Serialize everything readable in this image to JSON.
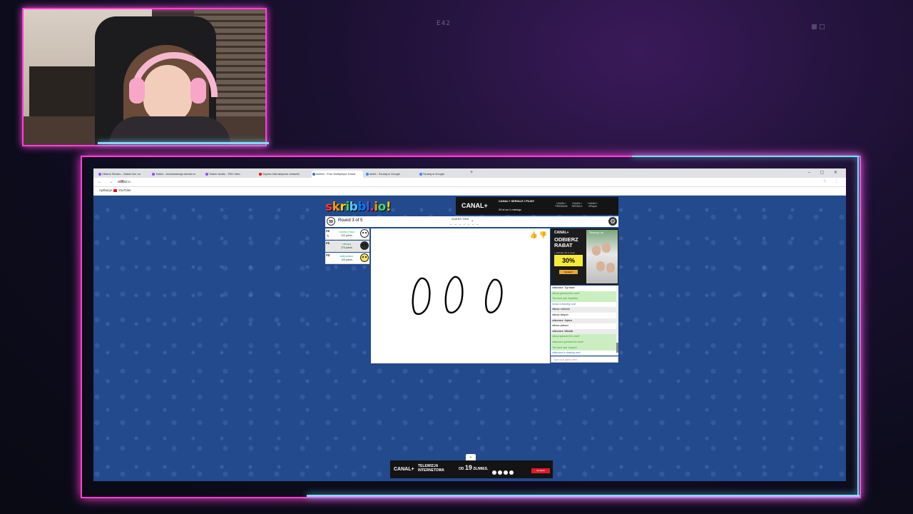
{
  "stream": {
    "label": "E42"
  },
  "browser": {
    "tabs": [
      {
        "label": "Villains Stream - Watch live on",
        "color": "#9146ff"
      },
      {
        "label": "Twitch - Administracja stream w",
        "color": "#9146ff"
      },
      {
        "label": "Twitch studio - REC filter",
        "color": "#9146ff"
      },
      {
        "label": "Gupies interaktywne zabawki",
        "color": "#ff0000"
      },
      {
        "label": "skribbl - Free Multiplayer Drawi",
        "color": "#3b6fd1",
        "active": true
      },
      {
        "label": "skribl - Szukaj w Google",
        "color": "#4285f4"
      },
      {
        "label": "Szukaj w Google",
        "color": "#4285f4"
      }
    ],
    "url": "skribbl.io",
    "bookmarks": [
      "Aplikacje",
      "YouTube"
    ]
  },
  "game": {
    "logo": [
      "s",
      "k",
      "r",
      "i",
      "b",
      "b",
      "l",
      ".",
      "i",
      "o",
      "!"
    ],
    "logo_colors": [
      "#ff3b30",
      "#ff9500",
      "#ffcc00",
      "#4cd964",
      "#5ac8fa",
      "#007aff",
      "#5856d6",
      "#ff2d55",
      "#ff9500",
      "#4cd964",
      "#ffcc00"
    ],
    "timer": "59",
    "round": "Round 3 of 5",
    "guess_label": "GUESS THIS",
    "hint": "_ _ _ _ _ _ _",
    "hint_count": "7",
    "players": [
      {
        "rank": "#2",
        "name": "rozwa (You)",
        "points": "220 points",
        "avatar": "#ffffff",
        "drawing": true
      },
      {
        "rank": "#1",
        "name": "nikusa",
        "points": "375 points",
        "avatar": "#2b2b2b"
      },
      {
        "rank": "#3",
        "name": "odkurzacz",
        "points": "125 points",
        "avatar": "#f5e15a"
      }
    ],
    "chat": [
      {
        "text": "odkurzacz: Typ twarz",
        "style": "normal"
      },
      {
        "text": "nikusa guessed the word!",
        "style": "green"
      },
      {
        "text": "The word was 'torpedka'",
        "style": "green"
      },
      {
        "text": "rozwa is drawing now!",
        "style": "blue"
      },
      {
        "text": "nikusa: ruchome",
        "style": "alt"
      },
      {
        "text": "nikusa: tampon",
        "style": "normal"
      },
      {
        "text": "odkurzacz: Jajnica",
        "style": "alt"
      },
      {
        "text": "nikusa: plaszcz",
        "style": "normal"
      },
      {
        "text": "odkurzacz: Wkladki",
        "style": "alt"
      },
      {
        "text": "nikusa guessed the word!",
        "style": "green"
      },
      {
        "text": "odkurzacz guessed the word!",
        "style": "green"
      },
      {
        "text": "The word was 'rezyseri'",
        "style": "green"
      },
      {
        "text": "odkurzacz is drawing now!",
        "style": "blue"
      }
    ],
    "chat_placeholder": "Type your guess here...",
    "thumbs": {
      "up": "👍",
      "down": "👎"
    }
  },
  "ads": {
    "top": {
      "brand": "CANAL+",
      "line1": "CANAL+ SERIALE I FILMY",
      "line2": "29 zł za 1 miesiąc",
      "logos": [
        "CANAL+ PREMIUM",
        "CANAL+ SERIALE",
        "CANAL+ nPlayer"
      ]
    },
    "side": {
      "brand": "CANAL+",
      "headline": "ODBIERZ RABAT",
      "sub": "+ dekoder 4K w cenie",
      "percent": "30%",
      "button": "Sprawdź",
      "photo_title": "Ślepnąc od"
    },
    "bottom": {
      "brand": "CANAL+",
      "tv": "TELEWIZJA INTERNETOWA",
      "price_prefix": "OD",
      "price": "19",
      "price_suffix": "ZŁ/MIES.",
      "cta": "Sprawdź"
    }
  }
}
